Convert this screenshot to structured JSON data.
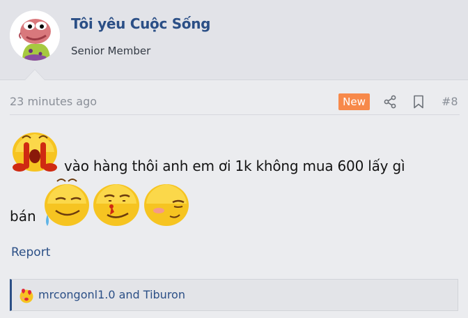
{
  "user": {
    "name": "Tôi yêu Cuộc Sống",
    "title": "Senior Member",
    "avatar_icon": "pepe-frog-avatar"
  },
  "post": {
    "timestamp": "23 minutes ago",
    "badge": "New",
    "number": "#8",
    "actions": [
      "share-icon",
      "bookmark-icon"
    ],
    "message_line1": "vào hàng thôi anh em ơi 1k không mua 600 lấy gì",
    "message_line2": "bán",
    "emojis": [
      "crying-blood-emoji",
      "sweating-smile-emoji",
      "bleeding-nose-emoji",
      "embarrassed-emoji"
    ]
  },
  "report_label": "Report",
  "reactions": {
    "icon": "love-kiss-emoji",
    "text": "mrcongonl1.0 and Tiburon"
  },
  "colors": {
    "accent": "#2b4f86",
    "badge": "#f7894a"
  }
}
